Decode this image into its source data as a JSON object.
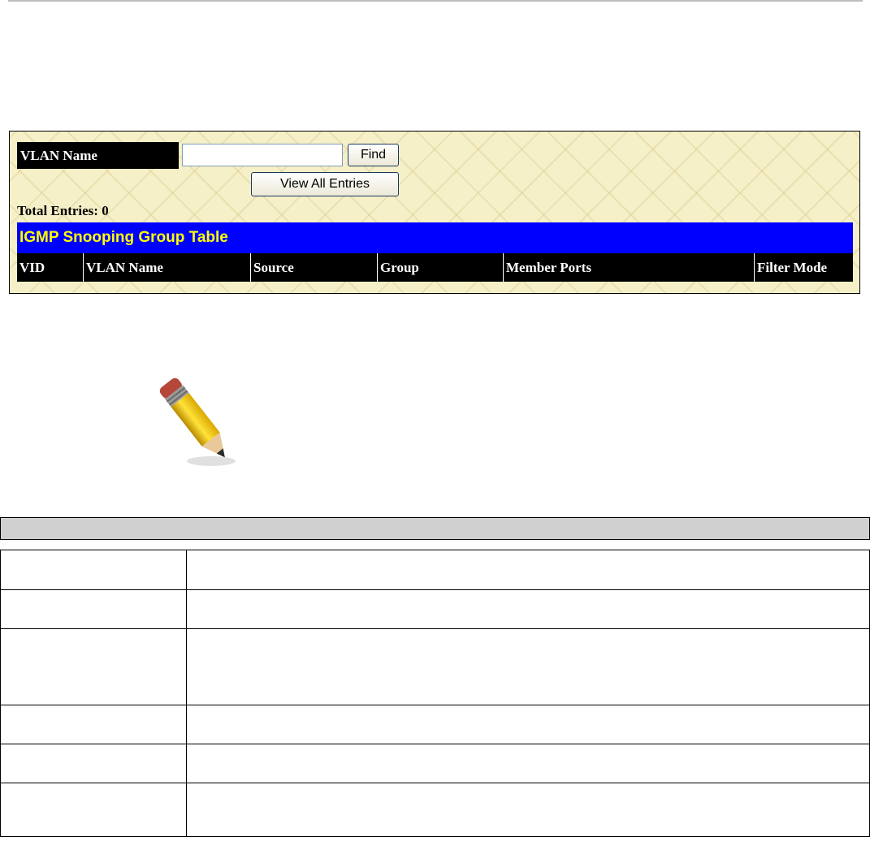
{
  "panel": {
    "vlan_label": "VLAN Name",
    "vlan_input_value": "",
    "find_button": "Find",
    "view_all_button": "View All Entries",
    "total_entries": "Total Entries: 0",
    "table_title": "IGMP Snooping Group Table",
    "columns": [
      "VID",
      "VLAN Name",
      "Source",
      "Group",
      "Member Ports",
      "Filter Mode"
    ]
  },
  "note": {
    "icon": "pencil-icon"
  },
  "description_table": {
    "header": "",
    "rows": [
      {
        "parameter": "",
        "description": ""
      },
      {
        "parameter": "",
        "description": ""
      },
      {
        "parameter": "",
        "description": ""
      },
      {
        "parameter": "",
        "description": ""
      },
      {
        "parameter": "",
        "description": ""
      },
      {
        "parameter": "",
        "description": ""
      }
    ]
  },
  "colors": {
    "panel_bg": "#f6f0c8",
    "title_bg": "#0000ff",
    "title_text": "#ffff00",
    "header_bg": "#000000",
    "gray_bar": "#d0d0d0"
  }
}
